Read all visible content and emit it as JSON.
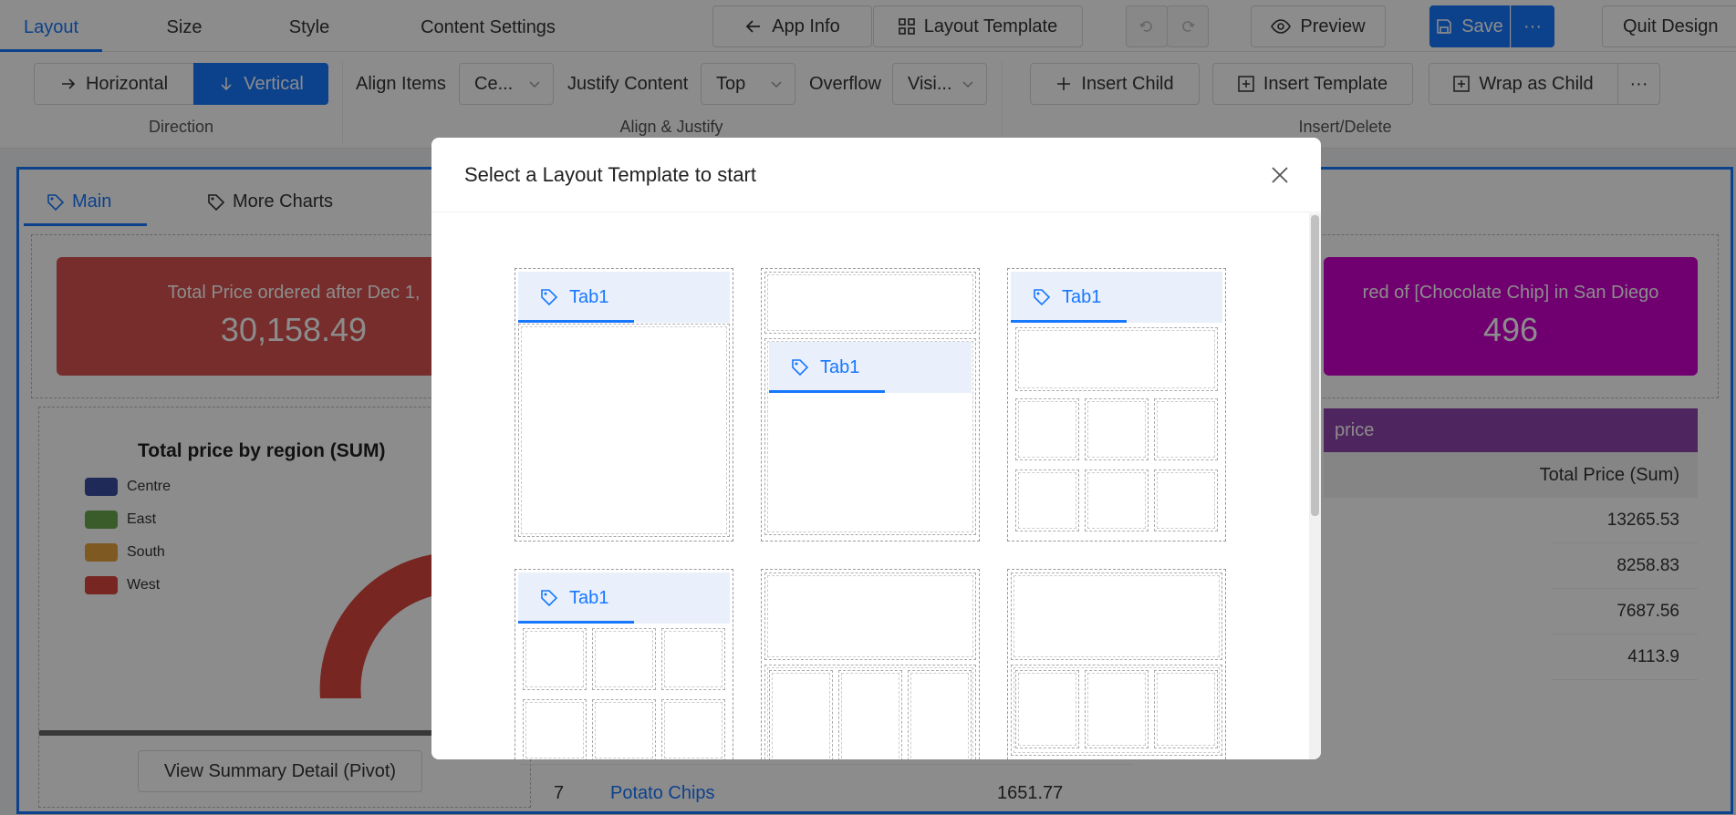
{
  "topbar": {
    "tabs": [
      {
        "label": "Layout",
        "active": true
      },
      {
        "label": "Size"
      },
      {
        "label": "Style"
      },
      {
        "label": "Content Settings"
      }
    ],
    "app_info": "App Info",
    "layout_template": "Layout Template",
    "preview": "Preview",
    "save": "Save",
    "more": "···",
    "quit": "Quit Design"
  },
  "ribbon": {
    "horizontal": "Horizontal",
    "vertical": "Vertical",
    "direction_caption": "Direction",
    "align_items_label": "Align Items",
    "align_items_value": "Ce...",
    "justify_label": "Justify Content",
    "justify_value": "Top",
    "overflow_label": "Overflow",
    "overflow_value": "Visi...",
    "align_caption": "Align & Justify",
    "insert_child": "Insert Child",
    "insert_template": "Insert Template",
    "wrap_as_child": "Wrap as Child",
    "more": "···",
    "insert_caption": "Insert/Delete"
  },
  "dashboard": {
    "tab_main": "Main",
    "tab_more": "More Charts",
    "kpi_left_title": "Total Price ordered after Dec 1,",
    "kpi_left_value": "30,158.49",
    "kpi_right_title": "red of [Chocolate Chip] in San Diego",
    "kpi_right_value": "496",
    "chart_title": "Total price by region (SUM)",
    "legend": [
      "Centre",
      "East",
      "South",
      "West"
    ],
    "table_header": "price",
    "table_col": "Total Price (Sum)",
    "table_values": [
      "13265.53",
      "8258.83",
      "7687.56",
      "4113.9"
    ],
    "row_index": "7",
    "row_name": "Potato Chips",
    "row_value": "1651.77",
    "pivot_button": "View Summary Detail (Pivot)"
  },
  "colors": {
    "accent": "#1677ff",
    "kpi_left": "#d9534f",
    "kpi_right": "#cc00cc",
    "table_header": "#8e44ad",
    "centre": "#3b4ea0",
    "east": "#6aa84f",
    "south": "#e6a23c",
    "west": "#d9463e"
  },
  "modal": {
    "title": "Select a Layout Template to start",
    "tab_label": "Tab1"
  }
}
